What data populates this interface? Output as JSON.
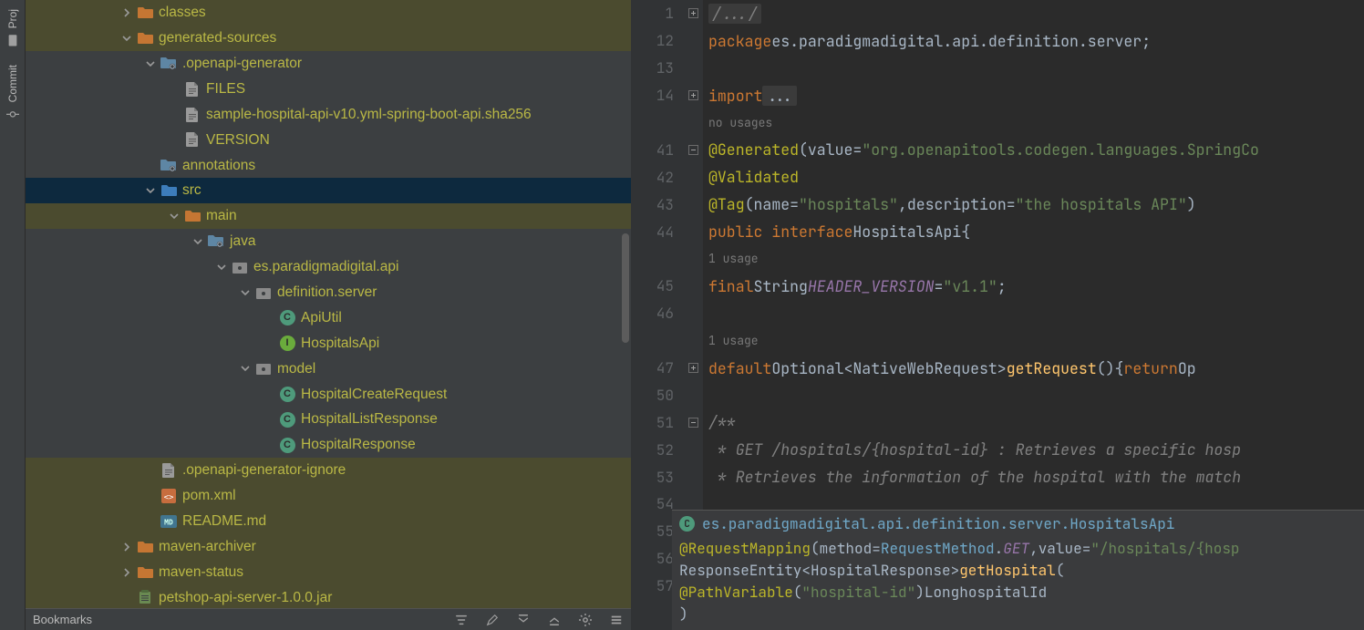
{
  "rail": {
    "project": "Proj",
    "commit": "Commit"
  },
  "tree": {
    "rows": [
      {
        "indent": 4,
        "arrow": ">",
        "icon": "folder-orange",
        "label": "classes",
        "style": "highlight"
      },
      {
        "indent": 4,
        "arrow": "v",
        "icon": "folder-orange",
        "label": "generated-sources",
        "style": "highlight"
      },
      {
        "indent": 5,
        "arrow": "v",
        "icon": "folder-gear",
        "label": ".openapi-generator",
        "style": ""
      },
      {
        "indent": 6,
        "arrow": "",
        "icon": "file",
        "label": "FILES",
        "style": ""
      },
      {
        "indent": 6,
        "arrow": "",
        "icon": "file",
        "label": "sample-hospital-api-v10.yml-spring-boot-api.sha256",
        "style": ""
      },
      {
        "indent": 6,
        "arrow": "",
        "icon": "file",
        "label": "VERSION",
        "style": ""
      },
      {
        "indent": 5,
        "arrow": "",
        "icon": "folder-gear",
        "label": "annotations",
        "style": ""
      },
      {
        "indent": 5,
        "arrow": "v",
        "icon": "folder-blue",
        "label": "src",
        "style": "selected"
      },
      {
        "indent": 6,
        "arrow": "v",
        "icon": "folder-orange",
        "label": "main",
        "style": "highlight"
      },
      {
        "indent": 7,
        "arrow": "v",
        "icon": "folder-gear",
        "label": "java",
        "style": ""
      },
      {
        "indent": 8,
        "arrow": "v",
        "icon": "package",
        "label": "es.paradigmadigital.api",
        "style": ""
      },
      {
        "indent": 9,
        "arrow": "v",
        "icon": "package",
        "label": "definition.server",
        "style": ""
      },
      {
        "indent": 10,
        "arrow": "",
        "icon": "class-c",
        "label": "ApiUtil",
        "style": ""
      },
      {
        "indent": 10,
        "arrow": "",
        "icon": "class-i",
        "label": "HospitalsApi",
        "style": ""
      },
      {
        "indent": 9,
        "arrow": "v",
        "icon": "package",
        "label": "model",
        "style": ""
      },
      {
        "indent": 10,
        "arrow": "",
        "icon": "class-c",
        "label": "HospitalCreateRequest",
        "style": ""
      },
      {
        "indent": 10,
        "arrow": "",
        "icon": "class-c",
        "label": "HospitalListResponse",
        "style": ""
      },
      {
        "indent": 10,
        "arrow": "",
        "icon": "class-c",
        "label": "HospitalResponse",
        "style": ""
      },
      {
        "indent": 5,
        "arrow": "",
        "icon": "file",
        "label": ".openapi-generator-ignore",
        "style": "highlight2"
      },
      {
        "indent": 5,
        "arrow": "",
        "icon": "xml",
        "label": "pom.xml",
        "style": "highlight2"
      },
      {
        "indent": 5,
        "arrow": "",
        "icon": "md",
        "label": "README.md",
        "style": "highlight2"
      },
      {
        "indent": 4,
        "arrow": ">",
        "icon": "folder-orange",
        "label": "maven-archiver",
        "style": "highlight2"
      },
      {
        "indent": 4,
        "arrow": ">",
        "icon": "folder-orange",
        "label": "maven-status",
        "style": "highlight2"
      },
      {
        "indent": 4,
        "arrow": "",
        "icon": "jar",
        "label": "petshop-api-server-1.0.0.jar",
        "style": "highlight2"
      }
    ]
  },
  "statusbar": {
    "left": "Bookmarks"
  },
  "editor": {
    "lines": [
      {
        "n": "1",
        "fold": "+",
        "html": "<span class='tok-cmt box'>/.../</span>"
      },
      {
        "n": "12",
        "fold": "",
        "html": "<span class='tok-kw'>package</span> <span class='tok-type'>es.paradigmadigital.api.definition.server</span><span class='tok-punc'>;</span>"
      },
      {
        "n": "13",
        "fold": "",
        "html": ""
      },
      {
        "n": "14",
        "fold": "+",
        "html": "<span class='tok-kw'>import</span> <span class='tok-type box'>...</span>"
      },
      {
        "n": "",
        "fold": "",
        "html": "<span class='hint'>no usages</span>"
      },
      {
        "n": "41",
        "fold": "-",
        "html": "<span class='tok-ann'>@Generated</span><span class='tok-punc'>(</span><span class='tok-type'>value</span> <span class='tok-punc'>=</span> <span class='tok-str'>\"org.openapitools.codegen.languages.SpringCo</span>"
      },
      {
        "n": "42",
        "fold": "",
        "html": "<span class='tok-ann'>@Validated</span>"
      },
      {
        "n": "43",
        "fold": "",
        "html": "<span class='tok-ann'>@Tag</span><span class='tok-punc'>(</span><span class='tok-type'>name</span> <span class='tok-punc'>=</span> <span class='tok-str'>\"hospitals\"</span><span class='tok-punc'>,</span> <span class='tok-type'>description</span> <span class='tok-punc'>=</span> <span class='tok-str'>\"the hospitals API\"</span><span class='tok-punc'>)</span>"
      },
      {
        "n": "44",
        "fold": "",
        "html": "<span class='tok-kw'>public interface</span> <span class='tok-type'>HospitalsApi</span> <span class='tok-punc'>{</span>"
      },
      {
        "n": "",
        "fold": "",
        "html": "    <span class='hint'>1 usage</span>"
      },
      {
        "n": "45",
        "fold": "",
        "html": "    <span class='tok-kw'>final</span> <span class='tok-type'>String</span> <span class='tok-field'>HEADER_VERSION</span> <span class='tok-punc'>=</span> <span class='tok-str'>\"v1.1\"</span><span class='tok-punc'>;</span>"
      },
      {
        "n": "46",
        "fold": "",
        "html": ""
      },
      {
        "n": "",
        "fold": "",
        "html": "    <span class='hint'>1 usage</span>"
      },
      {
        "n": "47",
        "fold": "+",
        "html": "    <span class='tok-kw'>default</span> <span class='tok-type'>Optional&lt;NativeWebRequest&gt;</span> <span class='tok-meth'>getRequest</span><span class='tok-punc'>()</span> <span class='tok-punc'>{</span> <span class='tok-kw'>return</span> <span class='tok-type'>Op</span>"
      },
      {
        "n": "50",
        "fold": "",
        "html": ""
      },
      {
        "n": "51",
        "fold": "-",
        "html": "    <span class='tok-cmt'>/**</span>"
      },
      {
        "n": "52",
        "fold": "",
        "html": "    <span class='tok-cmt'> * GET /hospitals/{hospital-id} : Retrieves a specific hosp</span>"
      },
      {
        "n": "53",
        "fold": "",
        "html": "    <span class='tok-cmt'> * Retrieves the information of the hospital with the match</span>"
      },
      {
        "n": "54",
        "fold": "",
        "html": ""
      },
      {
        "n": "55",
        "fold": "",
        "html": ""
      },
      {
        "n": "56",
        "fold": "",
        "html": ""
      },
      {
        "n": "57",
        "fold": "",
        "html": ""
      }
    ]
  },
  "doc": {
    "breadcrumb": "es.paradigmadigital.api.definition.server.HospitalsApi",
    "lines": [
      "<span class='tok-ann'>@RequestMapping</span><span class='tok-punc'>(</span><span class='tok-type'>method</span> <span class='tok-punc'>=</span> <span class='tok-type' style='color:#6fa7c7'>RequestMethod</span><span class='tok-punc'>.</span><span class='tok-field' style='color:#9876aa'>GET</span><span class='tok-punc'>,</span>  <span class='tok-type'>value</span> <span class='tok-punc'>=</span> <span class='tok-str'>\"/hospitals/{hosp</span>",
      "<span class='tok-type'>ResponseEntity&lt;HospitalResponse&gt;</span> <span class='tok-meth'>getHospital</span><span class='tok-punc'>(</span>",
      "    <span class='tok-ann'>@PathVariable</span><span class='tok-punc'>(</span><span class='tok-str'>\"hospital-id\"</span><span class='tok-punc'>)</span> <span class='tok-type'>Long</span> <span class='tok-type'>hospitalId</span>",
      "<span class='tok-punc'>)</span>"
    ]
  }
}
